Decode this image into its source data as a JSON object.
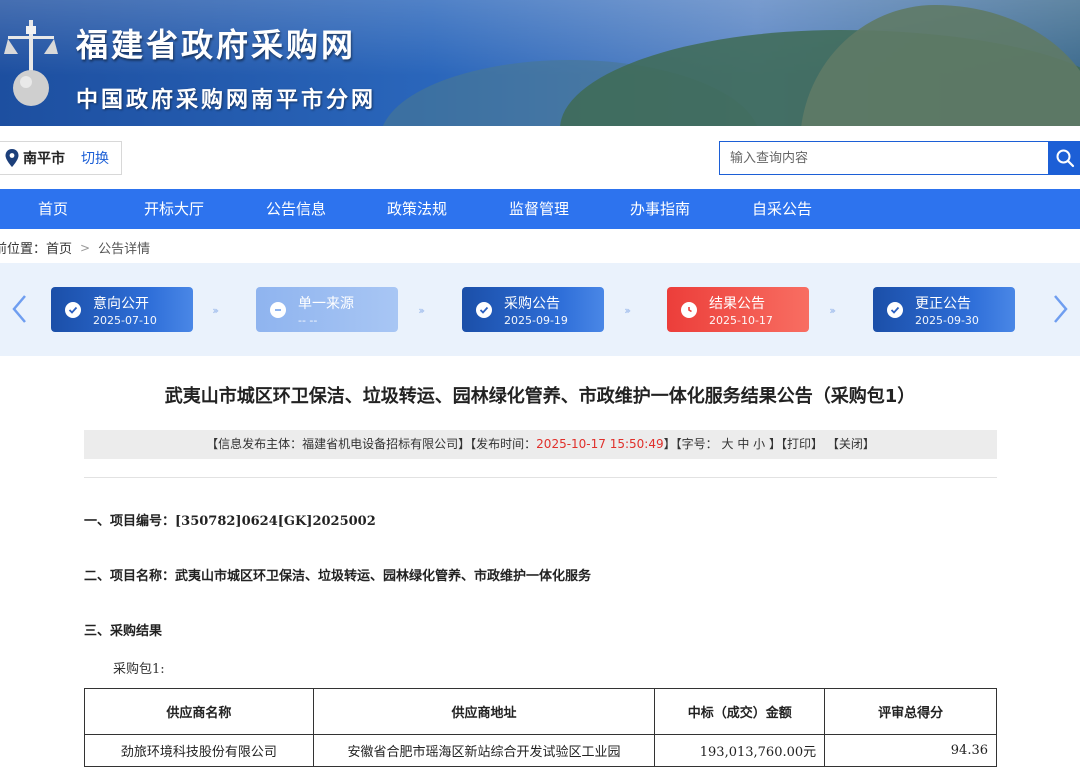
{
  "banner": {
    "title": "福建省政府采购网",
    "subtitle": "中国政府采购网南平市分网"
  },
  "location": {
    "city": "南平市",
    "switch_label": "切换"
  },
  "search": {
    "placeholder": "输入查询内容"
  },
  "nav": {
    "items": [
      {
        "label": "首页"
      },
      {
        "label": "开标大厅"
      },
      {
        "label": "公告信息"
      },
      {
        "label": "政策法规"
      },
      {
        "label": "监督管理"
      },
      {
        "label": "办事指南"
      },
      {
        "label": "自采公告"
      }
    ]
  },
  "breadcrumb": {
    "prefix": "前位置：",
    "home": "首页",
    "current": "公告详情"
  },
  "timeline": {
    "steps": [
      {
        "name": "意向公开",
        "date": "2025-07-10",
        "state": "done"
      },
      {
        "name": "单一来源",
        "date": "-- --",
        "state": "disabled"
      },
      {
        "name": "采购公告",
        "date": "2025-09-19",
        "state": "done"
      },
      {
        "name": "结果公告",
        "date": "2025-10-17",
        "state": "current"
      },
      {
        "name": "更正公告",
        "date": "2025-09-30",
        "state": "done"
      }
    ]
  },
  "article": {
    "title": "武夷山市城区环卫保洁、垃圾转运、园林绿化管养、市政维护一体化服务结果公告（采购包1）",
    "info": {
      "publisher_prefix": "【信息发布主体：",
      "publisher": "福建省机电设备招标有限公司",
      "publisher_suffix": "】【发布时间：",
      "time": "2025-10-17 15:50:49",
      "font_prefix": "】【字号：",
      "font_large": "大",
      "font_medium": "中",
      "font_small": "小",
      "print": "【打印】",
      "close": "【关闭】"
    },
    "section1": "一、项目编号：[350782]0624[GK]2025002",
    "section2": "二、项目名称：武夷山市城区环卫保洁、垃圾转运、园林绿化管养、市政维护一体化服务",
    "section3": "三、采购结果",
    "package_label": "采购包1:",
    "table": {
      "headers": [
        "供应商名称",
        "供应商地址",
        "中标（成交）金额",
        "评审总得分"
      ],
      "rows": [
        [
          "劲旅环境科技股份有限公司",
          "安徽省合肥市瑶海区新站综合开发试验区工业园",
          "193,013,760.00元",
          "94.36"
        ]
      ]
    }
  },
  "colors": {
    "nav_bg": "#2d73ee",
    "accent": "#1c5fd6",
    "current_step": "#ec3e3a",
    "time_highlight": "#e0302b"
  }
}
